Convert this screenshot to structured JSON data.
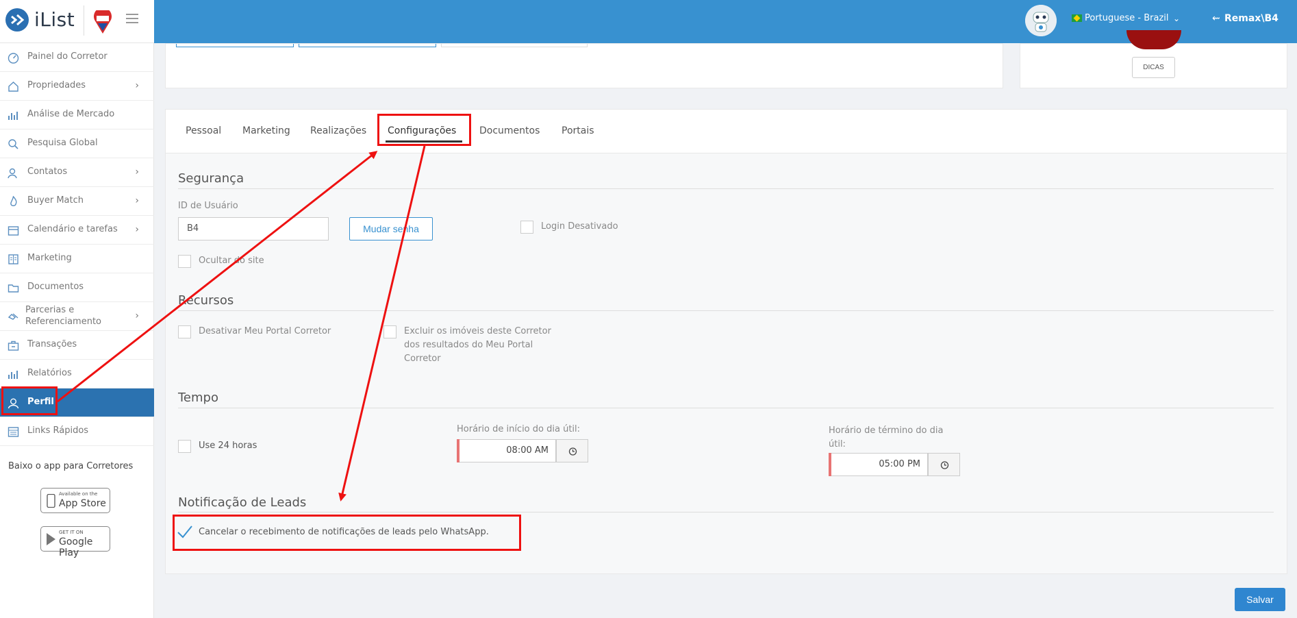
{
  "header": {
    "logo_text": "iList",
    "language": "Portuguese - Brazil",
    "user": "Remax\\B4"
  },
  "sidebar": {
    "items": [
      {
        "label": "Painel do Corretor",
        "icon": "dashboard-icon",
        "chevron": false
      },
      {
        "label": "Propriedades",
        "icon": "home-icon",
        "chevron": true
      },
      {
        "label": "Análise de Mercado",
        "icon": "bar-chart-icon",
        "chevron": false
      },
      {
        "label": "Pesquisa Global",
        "icon": "search-icon",
        "chevron": false
      },
      {
        "label": "Contatos",
        "icon": "contacts-icon",
        "chevron": true
      },
      {
        "label": "Buyer Match",
        "icon": "flame-icon",
        "chevron": true
      },
      {
        "label": "Calendário e tarefas",
        "icon": "calendar-icon",
        "chevron": true
      },
      {
        "label": "Marketing",
        "icon": "book-icon",
        "chevron": false
      },
      {
        "label": "Documentos",
        "icon": "folder-icon",
        "chevron": false
      },
      {
        "label_line1": "Parcerias e",
        "label_line2": "Referenciamento",
        "icon": "handshake-icon",
        "chevron": true
      },
      {
        "label": "Transações",
        "icon": "briefcase-icon",
        "chevron": false
      },
      {
        "label": "Relatórios",
        "icon": "report-chart-icon",
        "chevron": false
      },
      {
        "label": "Perfil",
        "icon": "user-icon",
        "chevron": false,
        "active": true
      },
      {
        "label": "Links Rápidos",
        "icon": "links-icon",
        "chevron": false
      }
    ],
    "app_caption": "Baixo o app para Corretores",
    "app_store": {
      "small": "Available on the",
      "big": "App Store"
    },
    "google_play": {
      "small": "GET IT ON",
      "big": "Google Play"
    }
  },
  "top_card": {
    "dicas_label": "DICAS"
  },
  "tabs": [
    "Pessoal",
    "Marketing",
    "Realizações",
    "Configurações",
    "Documentos",
    "Portais"
  ],
  "active_tab": "Configurações",
  "seguranca": {
    "title": "Segurança",
    "user_id_label": "ID de Usuário",
    "user_id_value": "B4",
    "change_password_label": "Mudar senha",
    "login_disabled_label": "Login Desativado",
    "hide_site_label": "Ocultar do site"
  },
  "recursos": {
    "title": "Recursos",
    "disable_portal_label": "Desativar Meu Portal Corretor",
    "exclude_line1": "Excluir os imóveis deste Corretor",
    "exclude_line2": "dos resultados do Meu Portal",
    "exclude_line3": "Corretor"
  },
  "tempo": {
    "title": "Tempo",
    "use24_label": "Use 24 horas",
    "start_label": "Horário de início do dia útil:",
    "start_value": "08:00 AM",
    "end_label_line1": "Horário de término do dia",
    "end_label_line2": "útil:",
    "end_value": "05:00 PM"
  },
  "leads": {
    "title": "Notificação de Leads",
    "whatsapp_label": "Cancelar o recebimento de notificações de leads pelo WhatsApp.",
    "whatsapp_checked": true
  },
  "save_label": "Salvar",
  "colors": {
    "header_blue": "#3891d0",
    "active_nav": "#2b72b0",
    "annotation_red": "#e11111"
  }
}
